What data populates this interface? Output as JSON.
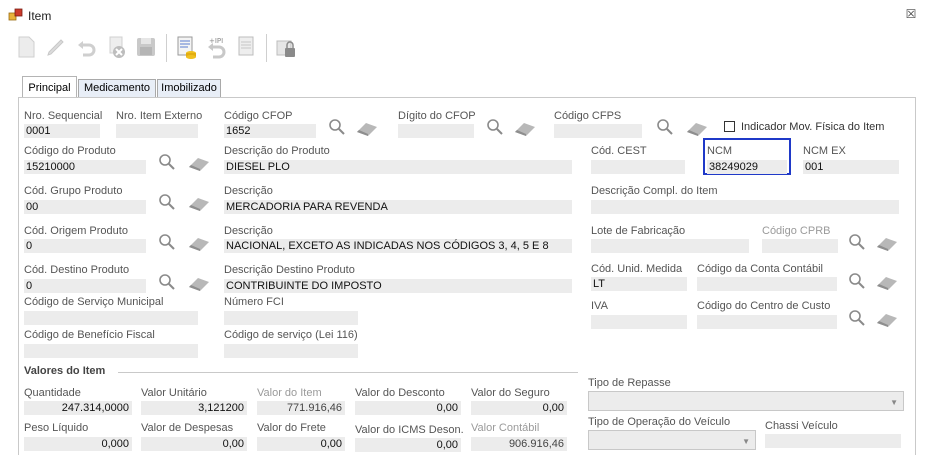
{
  "window": {
    "title": "Item",
    "close_glyph": "☒"
  },
  "toolbar": {
    "buttons": [
      {
        "icon": "new-doc-icon"
      },
      {
        "icon": "edit-icon"
      },
      {
        "icon": "undo-icon"
      },
      {
        "icon": "delete-icon"
      },
      {
        "icon": "save-icon"
      },
      {
        "icon": "calculator-icon"
      },
      {
        "icon": "ipi-icon"
      },
      {
        "icon": "print-icon"
      },
      {
        "icon": "lock-icon"
      }
    ]
  },
  "tabs": {
    "principal": "Principal",
    "medicamento": "Medicamento",
    "imobilizado": "Imobilizado"
  },
  "fields": {
    "nro_sequencial": {
      "label": "Nro. Sequencial",
      "value": "0001"
    },
    "nro_item_externo": {
      "label": "Nro. Item Externo",
      "value": ""
    },
    "codigo_cfop": {
      "label": "Código CFOP",
      "value": "1652"
    },
    "digito_cfop": {
      "label": "Dígito do CFOP",
      "value": ""
    },
    "codigo_cfps": {
      "label": "Código CFPS",
      "value": ""
    },
    "indicador_mov": {
      "label": "Indicador Mov. Física do Item",
      "checked": false
    },
    "codigo_produto": {
      "label": "Código do Produto",
      "value": "15210000"
    },
    "descricao_produto": {
      "label": "Descrição do Produto",
      "value": "DIESEL PLO"
    },
    "cod_cest": {
      "label": "Cód. CEST",
      "value": ""
    },
    "ncm": {
      "label": "NCM",
      "value": "38249029"
    },
    "ncm_ex": {
      "label": "NCM EX",
      "value": "001"
    },
    "cod_grupo_produto": {
      "label": "Cód. Grupo Produto",
      "value": "00"
    },
    "descricao_grupo": {
      "label": "Descrição",
      "value": "MERCADORIA PARA REVENDA"
    },
    "descricao_compl": {
      "label": "Descrição Compl. do Item",
      "value": ""
    },
    "cod_origem_produto": {
      "label": "Cód. Origem Produto",
      "value": "0"
    },
    "descricao_origem": {
      "label": "Descrição",
      "value": "NACIONAL, EXCETO AS INDICADAS NOS CÓDIGOS 3, 4, 5 E 8"
    },
    "lote_fabricacao": {
      "label": "Lote de Fabricação",
      "value": ""
    },
    "codigo_cprb": {
      "label": "Código CPRB",
      "value": ""
    },
    "cod_destino_produto": {
      "label": "Cód. Destino Produto",
      "value": "0"
    },
    "descricao_destino": {
      "label": "Descrição Destino Produto",
      "value": "CONTRIBUINTE DO IMPOSTO"
    },
    "cod_unid_medida": {
      "label": "Cód. Unid. Medida",
      "value": "LT"
    },
    "codigo_conta_contabil": {
      "label": "Código da Conta Contábil",
      "value": ""
    },
    "codigo_servico_municipal": {
      "label": "Código de Serviço Municipal",
      "value": ""
    },
    "numero_fci": {
      "label": "Número FCI",
      "value": ""
    },
    "iva": {
      "label": "IVA",
      "value": ""
    },
    "codigo_centro_custo": {
      "label": "Código do Centro de Custo",
      "value": ""
    },
    "codigo_beneficio_fiscal": {
      "label": "Código de Benefício Fiscal",
      "value": ""
    },
    "codigo_servico_lei116": {
      "label": "Código de serviço (Lei 116)",
      "value": ""
    }
  },
  "valores": {
    "title": "Valores do Item",
    "quantidade": {
      "label": "Quantidade",
      "value": "247.314,0000"
    },
    "valor_unitario": {
      "label": "Valor Unitário",
      "value": "3,121200"
    },
    "valor_item": {
      "label": "Valor do Item",
      "value": "771.916,46"
    },
    "valor_desconto": {
      "label": "Valor do Desconto",
      "value": "0,00"
    },
    "valor_seguro": {
      "label": "Valor do Seguro",
      "value": "0,00"
    },
    "peso_liquido": {
      "label": "Peso Líquido",
      "value": "0,000"
    },
    "valor_despesas": {
      "label": "Valor de Despesas",
      "value": "0,00"
    },
    "valor_frete": {
      "label": "Valor do  Frete",
      "value": "0,00"
    },
    "valor_icms_deson": {
      "label": "Valor do ICMS Deson.",
      "value": "0,00"
    },
    "valor_contabil": {
      "label": "Valor Contábil",
      "value": "906.916,46"
    },
    "tipo_repasse": {
      "label": "Tipo de Repasse",
      "value": ""
    },
    "tipo_operacao_veiculo": {
      "label": "Tipo de Operação do Veículo",
      "value": ""
    },
    "chassi_veiculo": {
      "label": "Chassi Veículo",
      "value": ""
    }
  },
  "colors": {
    "ncm_highlight": "#1f39c8",
    "field_bg": "#ececec"
  }
}
